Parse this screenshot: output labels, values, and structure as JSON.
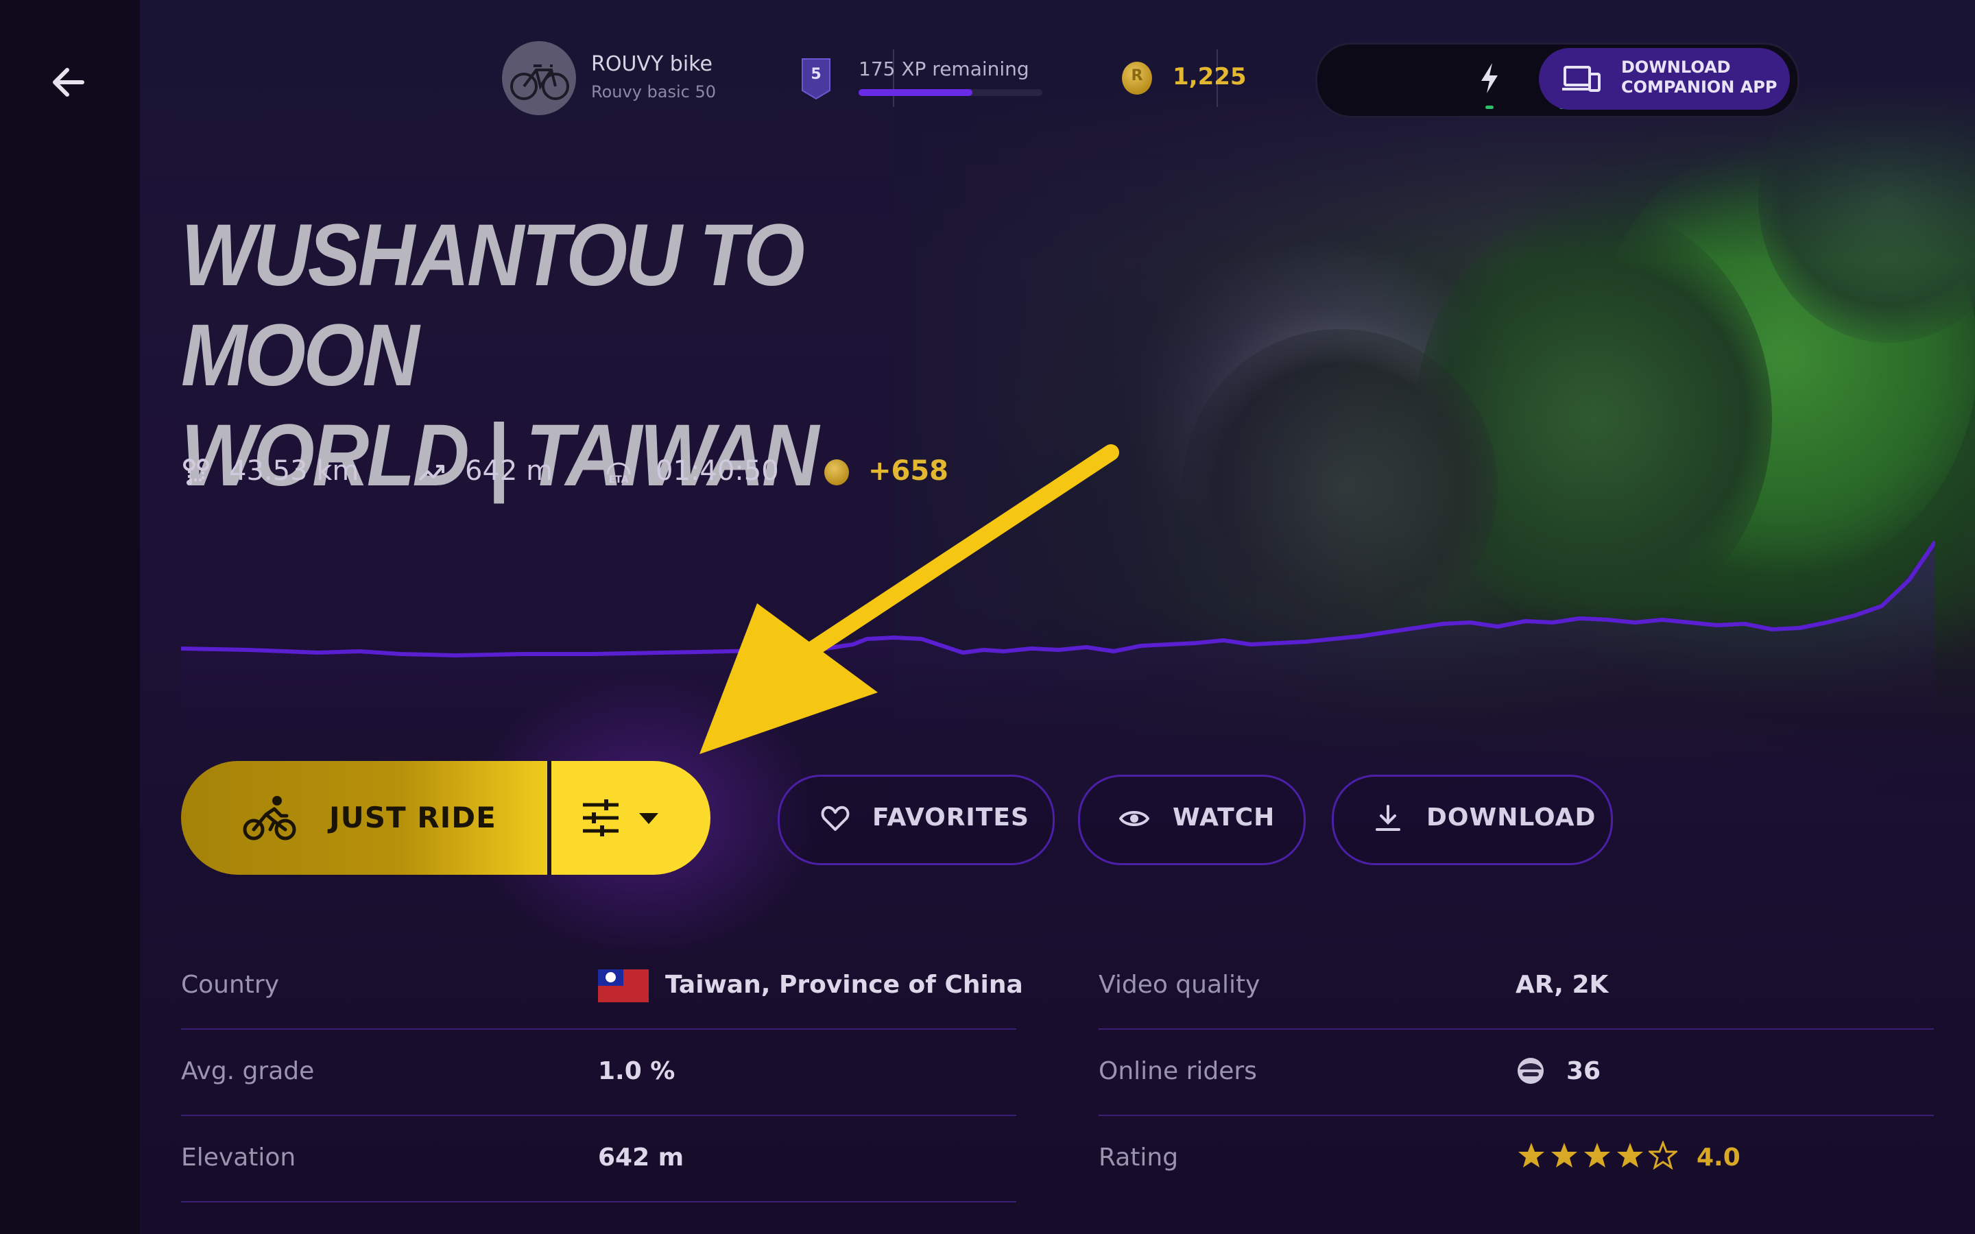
{
  "header": {
    "bike": {
      "title": "ROUVY bike",
      "subtitle": "Rouvy basic 50"
    },
    "level": {
      "number": "5",
      "xp_text": "175 XP remaining",
      "progress": 0.62
    },
    "coins": {
      "symbol": "R",
      "value": "1,225"
    },
    "devices": [
      "power-icon",
      "speed-sensor-icon",
      "heart-rate-icon"
    ],
    "companion": {
      "line1": "DOWNLOAD",
      "line2": "COMPANION APP"
    }
  },
  "route": {
    "title_line1": "WUSHANTOU TO MOON",
    "title_line2": "WORLD |  TAIWAN",
    "stats": {
      "distance": "43.53 km",
      "elevation": "642 m",
      "eta_label": "ETA",
      "eta": "01:40:50",
      "coins": "+658"
    }
  },
  "actions": {
    "just_ride": "JUST RIDE",
    "favorites": "FAVORITES",
    "watch": "WATCH",
    "download": "DOWNLOAD"
  },
  "info": {
    "left": [
      {
        "label": "Country",
        "value": "Taiwan, Province of China"
      },
      {
        "label": "Avg. grade",
        "value": "1.0 %"
      },
      {
        "label": "Elevation",
        "value": "642 m"
      }
    ],
    "right": [
      {
        "label": "Video quality",
        "value": "AR, 2K"
      },
      {
        "label": "Online riders",
        "value": "36"
      },
      {
        "label": "Rating",
        "value": "4.0"
      }
    ],
    "rating_stars": 4
  },
  "colors": {
    "accent_yellow": "#fbda2b",
    "accent_purple": "#6a2be6",
    "coin_gold": "#e3b72f",
    "profile_line": "#5a1fd0"
  }
}
